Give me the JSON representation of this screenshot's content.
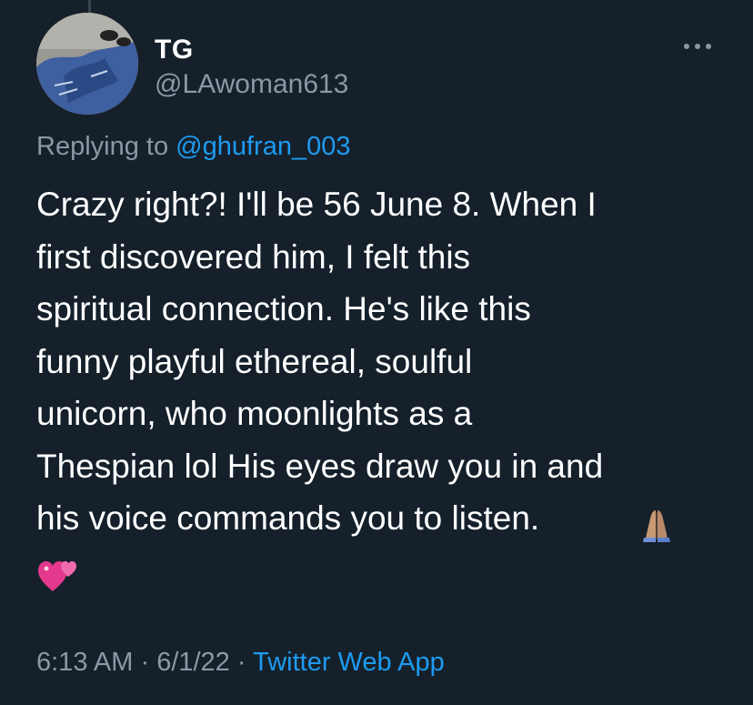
{
  "tweet": {
    "author": {
      "display_name": "TG",
      "handle": "@LAwoman613"
    },
    "reply": {
      "prefix": "Replying to ",
      "mention": "@ghufran_003"
    },
    "text": "Crazy right?! I'll be 56 June 8. When I\nfirst discovered him, I felt this\nspiritual connection. He's like this\nfunny playful ethereal, soulful\nunicorn, who moonlights as a\nThespian lol His eyes draw you in and\nhis voice commands you to listen.",
    "emojis": [
      "folded-hands-emoji",
      "two-hearts-emoji"
    ],
    "meta": {
      "time": "6:13 AM",
      "separator1": " · ",
      "date": "6/1/22",
      "separator2": " · ",
      "source": "Twitter Web App"
    }
  },
  "colors": {
    "background": "#15202b",
    "text": "#ffffff",
    "secondary": "#8b98a5",
    "accent": "#1d9bf0"
  },
  "icons": {
    "more": "more-horizontal-icon"
  }
}
